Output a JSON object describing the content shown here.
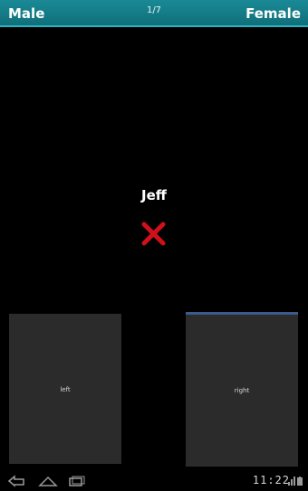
{
  "header": {
    "left_label": "Male",
    "counter": "1/7",
    "right_label": "Female",
    "background": "#0f6f7a"
  },
  "main": {
    "name": "Jeff",
    "result_icon": "close-icon",
    "result_color": "#d0101a"
  },
  "panels": {
    "left_label": "left",
    "right_label": "right"
  },
  "system_bar": {
    "clock": "11:22",
    "icons": [
      "back-icon",
      "home-icon",
      "recent-apps-icon",
      "signal-icon",
      "battery-icon"
    ]
  }
}
